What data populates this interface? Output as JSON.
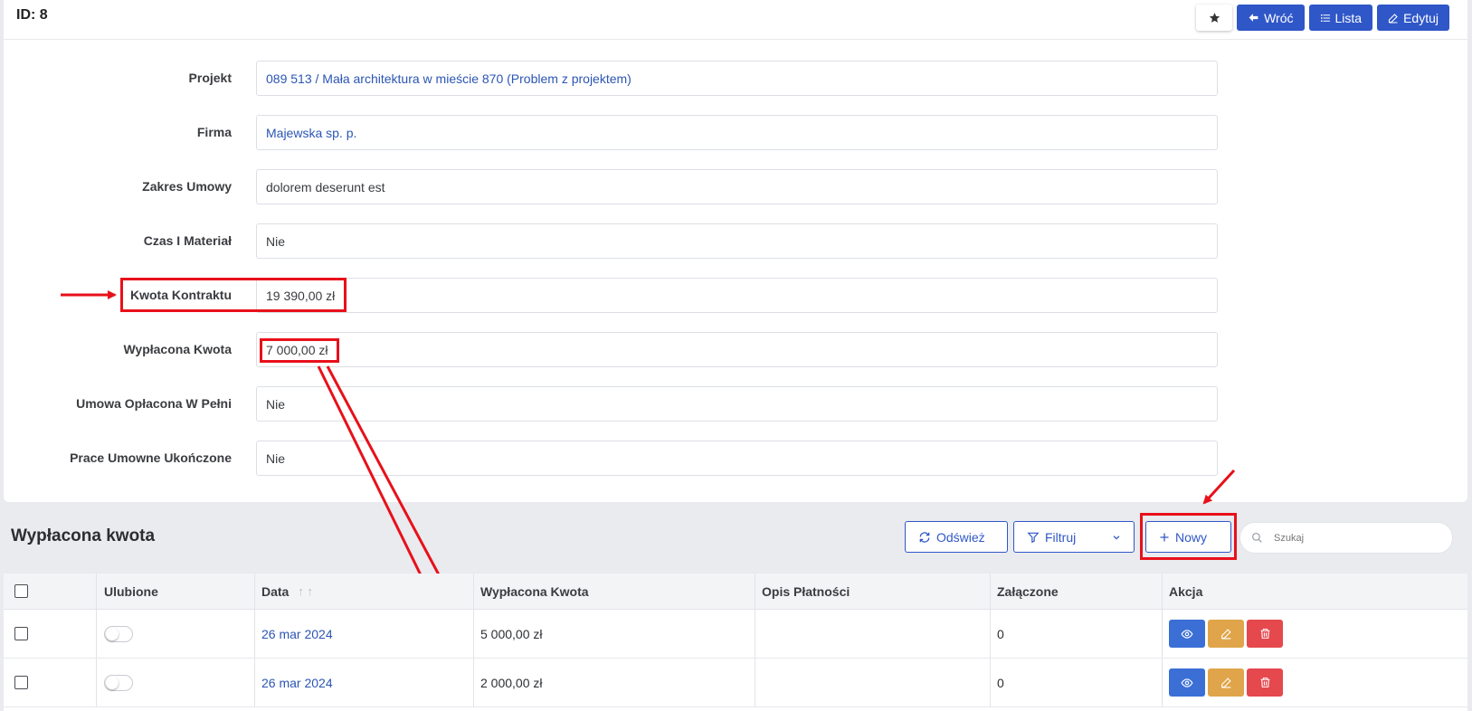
{
  "header": {
    "id_title": "ID: 8",
    "back_label": "Wróć",
    "list_label": "Lista",
    "edit_label": "Edytuj"
  },
  "fields": [
    {
      "label": "Projekt",
      "value": "089 513 / Mała architektura w mieście 870 (Problem z projektem)"
    },
    {
      "label": "Firma",
      "value": "Majewska sp. p."
    },
    {
      "label": "Zakres Umowy",
      "value": "dolorem deserunt est"
    },
    {
      "label": "Czas I Materiał",
      "value": "Nie"
    },
    {
      "label": "Kwota Kontraktu",
      "value": "19 390,00 zł"
    },
    {
      "label": "Wypłacona Kwota",
      "value": "7 000,00 zł"
    },
    {
      "label": "Umowa Opłacona W Pełni",
      "value": "Nie"
    },
    {
      "label": "Prace Umowne Ukończone",
      "value": "Nie"
    }
  ],
  "section": {
    "title": "Wypłacona kwota",
    "refresh_label": "Odśwież",
    "filter_label": "Filtruj",
    "new_label": "Nowy",
    "search_placeholder": "Szukaj"
  },
  "table": {
    "columns": [
      "Ulubione",
      "Data",
      "Wypłacona Kwota",
      "Opis Płatności",
      "Załączone",
      "Akcja"
    ],
    "rows": [
      {
        "date": "26 mar 2024",
        "amount": "5 000,00 zł",
        "description": "",
        "attached": "0"
      },
      {
        "date": "26 mar 2024",
        "amount": "2 000,00 zł",
        "description": "",
        "attached": "0"
      }
    ]
  },
  "colors": {
    "primary": "#2f57c8",
    "link": "#2b55b3",
    "annotation_red": "#e8101a",
    "view_button": "#3b6fd6",
    "edit_button": "#e0a54a",
    "delete_button": "#e5484d"
  }
}
